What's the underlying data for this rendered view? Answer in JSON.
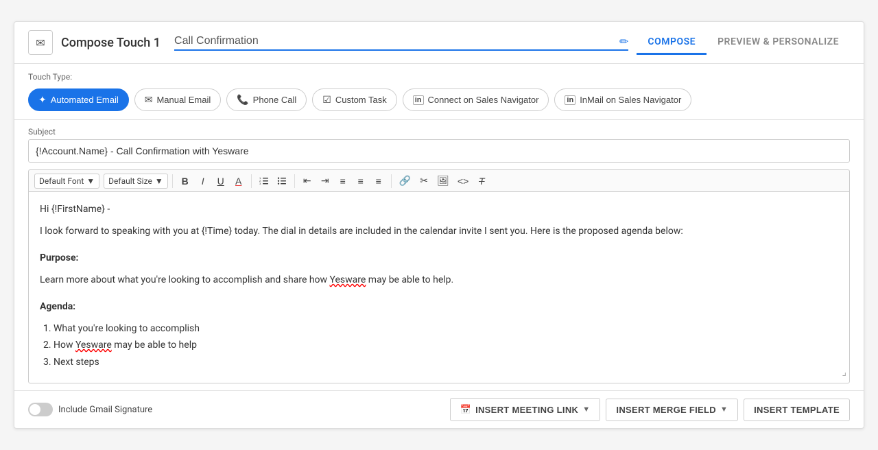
{
  "header": {
    "icon": "✉",
    "title": "Compose Touch 1",
    "touch_name": "Call Confirmation",
    "tab_compose": "COMPOSE",
    "tab_preview": "PREVIEW & PERSONALIZE"
  },
  "touch_type": {
    "label": "Touch Type:",
    "buttons": [
      {
        "id": "automated-email",
        "label": "Automated Email",
        "icon": "✦",
        "active": true
      },
      {
        "id": "manual-email",
        "label": "Manual Email",
        "icon": "✉",
        "active": false
      },
      {
        "id": "phone-call",
        "label": "Phone Call",
        "icon": "📞",
        "active": false
      },
      {
        "id": "custom-task",
        "label": "Custom Task",
        "icon": "☑",
        "active": false
      },
      {
        "id": "connect-sales-nav",
        "label": "Connect on Sales Navigator",
        "icon": "in",
        "active": false
      },
      {
        "id": "inmail-sales-nav",
        "label": "InMail on Sales Navigator",
        "icon": "in",
        "active": false
      }
    ]
  },
  "subject": {
    "label": "Subject",
    "value": "{!Account.Name} - Call Confirmation with Yesware"
  },
  "toolbar": {
    "font_family": "Default Font",
    "font_size": "Default Size",
    "buttons": [
      "B",
      "I",
      "U",
      "A",
      "OL",
      "UL",
      "◀▶",
      "⫤",
      "≡",
      "≡",
      "≡",
      "🔗",
      "✂",
      "🖼",
      "<>",
      "T"
    ]
  },
  "editor": {
    "greeting": "Hi {!FirstName} -",
    "paragraph1": "I look forward to speaking with you at {!Time} today. The dial in details are included in the calendar invite I sent you. Here is the proposed agenda below:",
    "purpose_header": "Purpose:",
    "purpose_text": "Learn more about what you're looking to accomplish and share how Yesware may be able to help.",
    "agenda_header": "Agenda:",
    "agenda_items": [
      "What you're looking to accomplish",
      "How Yesware may be able to help",
      "Next steps"
    ]
  },
  "footer": {
    "toggle_label": "Include Gmail Signature",
    "toggle_on": false,
    "btn_meeting_link": "INSERT MEETING LINK",
    "btn_merge_field": "INSERT MERGE FIELD",
    "btn_template": "INSERT TEMPLATE"
  }
}
